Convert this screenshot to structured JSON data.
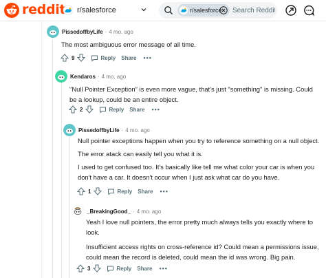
{
  "header": {
    "wordmark": "reddit",
    "subreddit": "r/salesforce",
    "search_chip": "r/salesforce",
    "search_placeholder": "Search Reddit"
  },
  "colors": {
    "brand": "#ff4500",
    "muted": "#576f76",
    "text": "#1c1c1c"
  },
  "icons": [
    "reddit-logo-icon",
    "subreddit-icon",
    "chevron-down-icon",
    "search-icon",
    "clear-icon",
    "advertise-icon",
    "chat-icon"
  ],
  "comments": [
    {
      "author": "PissedoffbyLife",
      "time": "4 mo. ago",
      "paragraphs": [
        "The most ambiguous error message of all time."
      ],
      "votes": "9",
      "reply": "Reply",
      "share": "Share",
      "more": "•••"
    },
    {
      "author": "Kendaros",
      "time": "4 mo. ago",
      "paragraphs": [
        "\"Null Pointer Exception\" is even more vague, that's just \"something\" is missing. Could be a lookup, could be an entire object."
      ],
      "votes": "2",
      "reply": "Reply",
      "share": "Share",
      "more": "•••"
    },
    {
      "author": "PissedoffbyLife",
      "time": "4 mo. ago",
      "paragraphs": [
        "Null pointer exceptions happen when you try to reference something on a null object.",
        "The error atack can easily tell you what it is.",
        "I used to get confused too. It's basically like tell me what color your car is when you don't have a car. It doesn't occur when I just ask what car do you have."
      ],
      "votes": "1",
      "reply": "Reply",
      "share": "Share",
      "more": "•••"
    },
    {
      "author": "_BreakingGood_",
      "time": "4 mo. ago",
      "paragraphs": [
        "Yeah I love null pointers, the error pretty much always tells you exactly where to look.",
        "Insufficient access rights on cross-reference id? Could mean a permissions issue, could mean the record is deleted, could mean the id was wrong. Big pain."
      ],
      "votes": "3",
      "reply": "Reply",
      "share": "Share",
      "more": "•••"
    }
  ]
}
